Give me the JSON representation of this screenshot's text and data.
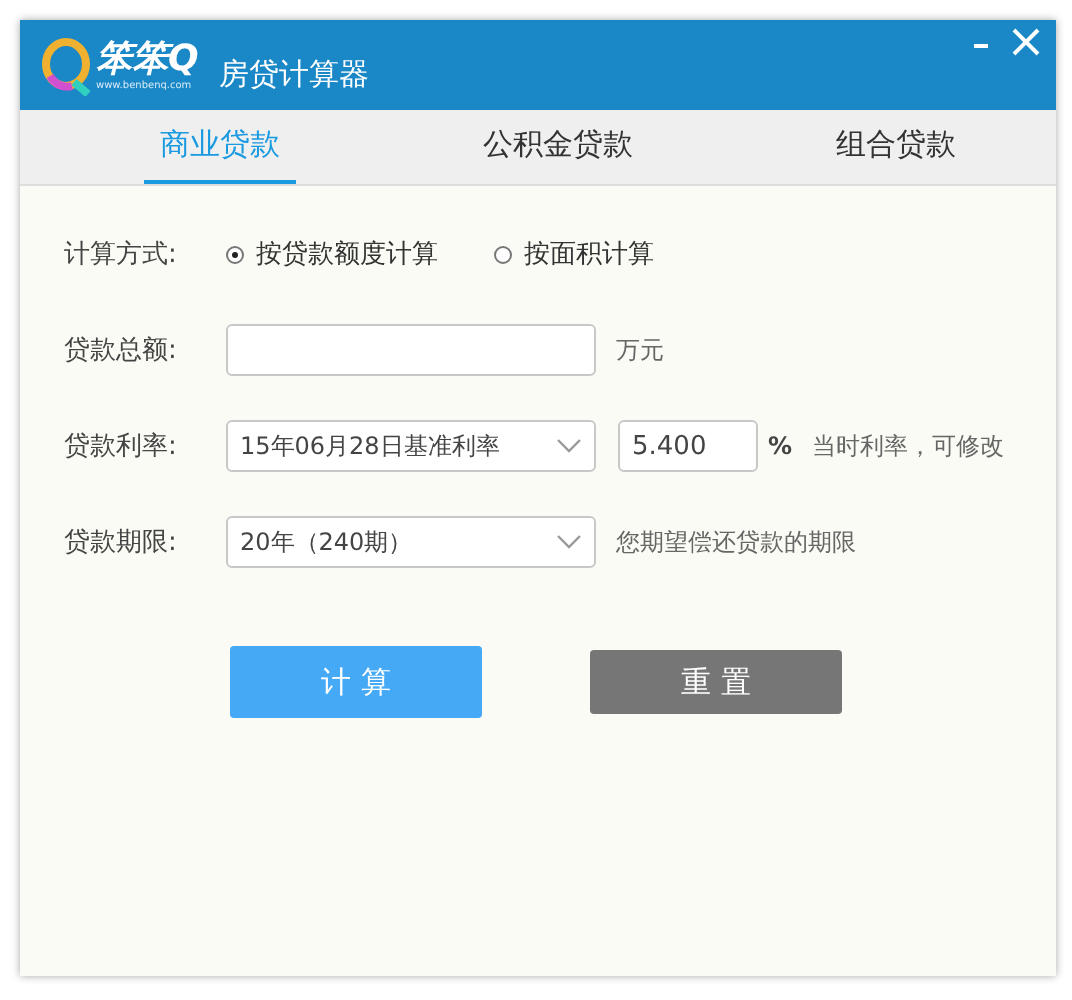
{
  "window": {
    "logo": {
      "name": "笨笨Q",
      "url": "www.benbenq.com"
    },
    "title": "房贷计算器"
  },
  "tabs": [
    {
      "label": "商业贷款",
      "selected": true
    },
    {
      "label": "公积金贷款",
      "selected": false
    },
    {
      "label": "组合贷款",
      "selected": false
    }
  ],
  "method": {
    "label": "计算方式:",
    "options": [
      {
        "label": "按贷款额度计算",
        "selected": true
      },
      {
        "label": "按面积计算",
        "selected": false
      }
    ]
  },
  "amount": {
    "label": "贷款总额:",
    "unit": "万元"
  },
  "rate": {
    "label": "贷款利率:",
    "select": "15年06月28日基准利率",
    "value": "5.400",
    "unit": "%",
    "hint": "当时利率，可修改"
  },
  "term": {
    "label": "贷款期限:",
    "select": "20年（240期）",
    "hint": "您期望偿还贷款的期限"
  },
  "buttons": [
    {
      "label": "计 算",
      "kind": "primary"
    },
    {
      "label": "重 置",
      "kind": "secondary"
    }
  ]
}
